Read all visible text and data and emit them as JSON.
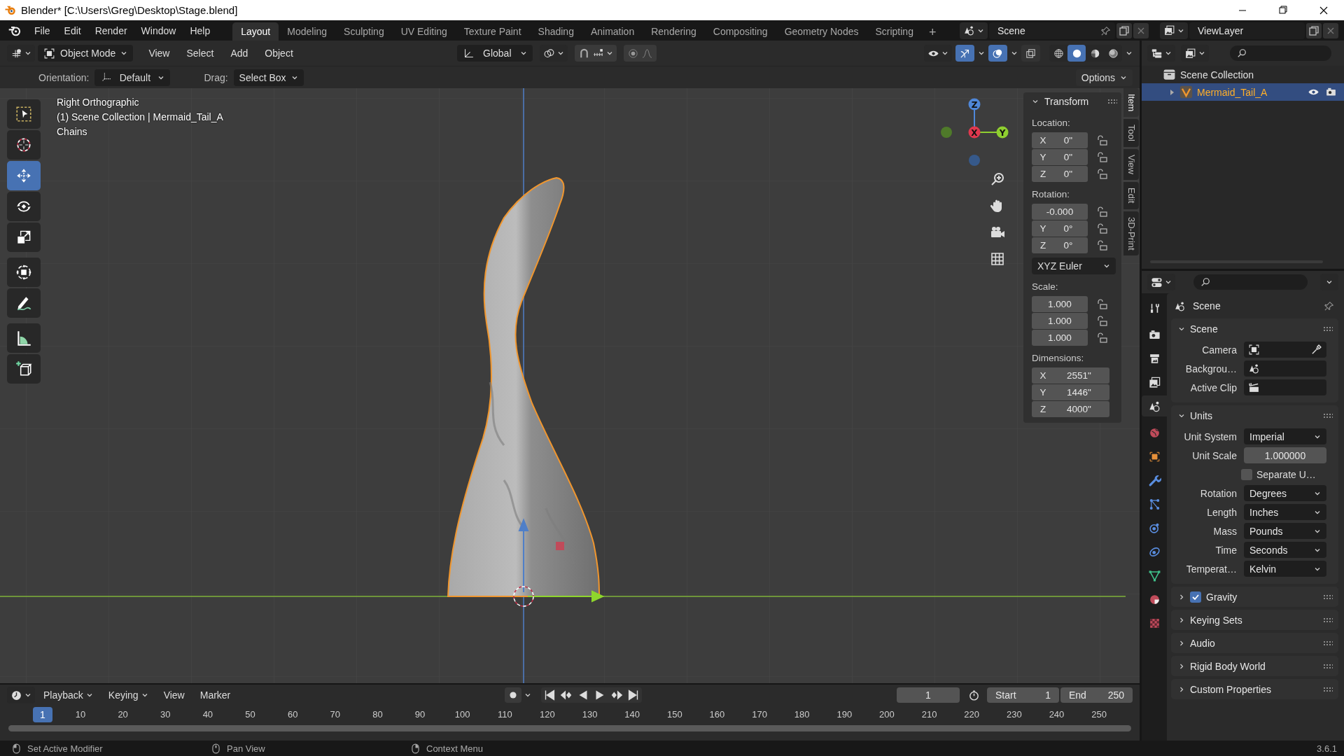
{
  "window": {
    "title": "Blender* [C:\\Users\\Greg\\Desktop\\Stage.blend]"
  },
  "menu": [
    "File",
    "Edit",
    "Render",
    "Window",
    "Help"
  ],
  "workspaces": [
    {
      "label": "Layout",
      "selected": true
    },
    {
      "label": "Modeling",
      "selected": false
    },
    {
      "label": "Sculpting",
      "selected": false
    },
    {
      "label": "UV Editing",
      "selected": false
    },
    {
      "label": "Texture Paint",
      "selected": false
    },
    {
      "label": "Shading",
      "selected": false
    },
    {
      "label": "Animation",
      "selected": false
    },
    {
      "label": "Rendering",
      "selected": false
    },
    {
      "label": "Compositing",
      "selected": false
    },
    {
      "label": "Geometry Nodes",
      "selected": false
    },
    {
      "label": "Scripting",
      "selected": false
    }
  ],
  "add_workspace": "+",
  "scene": "Scene",
  "view_layer": "ViewLayer",
  "viewport_header": {
    "mode": "Object Mode",
    "menus": [
      "View",
      "Select",
      "Add",
      "Object"
    ],
    "orientation": "Global",
    "gizmos_on": true,
    "overlays_on": true,
    "xray_on": false,
    "shading": [
      {
        "kind": "wireframe",
        "selected": false
      },
      {
        "kind": "solid",
        "selected": true
      },
      {
        "kind": "material",
        "selected": false
      },
      {
        "kind": "rendered",
        "selected": false
      }
    ]
  },
  "tool_settings": {
    "orientation_label": "Orientation:",
    "orientation": "Default",
    "drag_label": "Drag:",
    "drag": "Select Box",
    "options": "Options"
  },
  "viewport": {
    "lines": [
      "Right Orthographic",
      "(1) Scene Collection | Mermaid_Tail_A",
      "Chains"
    ]
  },
  "tools": [
    {
      "kind": "select",
      "selected": false
    },
    {
      "kind": "cursor",
      "selected": false
    },
    {
      "kind": "move",
      "selected": true
    },
    {
      "kind": "rotate",
      "selected": false
    },
    {
      "kind": "scale",
      "selected": false
    },
    {
      "kind": "transform",
      "selected": false
    },
    {
      "kind": "annotate",
      "selected": false
    },
    {
      "kind": "measure",
      "selected": false
    },
    {
      "kind": "addcube",
      "selected": false
    }
  ],
  "gizmo": {
    "z": "Z",
    "x": "X",
    "y": "Y"
  },
  "sidebar_tabs": [
    {
      "label": "Item",
      "selected": true
    },
    {
      "label": "Tool",
      "selected": false
    },
    {
      "label": "View",
      "selected": false
    },
    {
      "label": "Edit",
      "selected": false
    },
    {
      "label": "3D-Print",
      "selected": false
    }
  ],
  "transform": {
    "title": "Transform",
    "expanded": true,
    "groups": [
      {
        "label": "Location:",
        "locks": true,
        "rows": [
          {
            "axis": "X",
            "value": "0\""
          },
          {
            "axis": "Y",
            "value": "0\""
          },
          {
            "axis": "Z",
            "value": "0\""
          }
        ]
      },
      {
        "label": "Rotation:",
        "locks": true,
        "rows": [
          {
            "value": "-0.000"
          },
          {
            "axis": "Y",
            "value": "0°"
          },
          {
            "axis": "Z",
            "value": "0°"
          }
        ],
        "mode": "XYZ Euler"
      },
      {
        "label": "Scale:",
        "locks": true,
        "rows": [
          {
            "value": "1.000"
          },
          {
            "value": "1.000"
          },
          {
            "value": "1.000"
          }
        ]
      },
      {
        "label": "Dimensions:",
        "locks": false,
        "rows": [
          {
            "axis": "X",
            "value": "2551\""
          },
          {
            "axis": "Y",
            "value": "1446\""
          },
          {
            "axis": "Z",
            "value": "4000\""
          }
        ]
      }
    ]
  },
  "outliner": {
    "root": "Scene Collection",
    "items": [
      {
        "label": "Mermaid_Tail_A",
        "selected": true,
        "expanded": false,
        "visible": true
      }
    ]
  },
  "properties": {
    "context": "Scene",
    "tabs": [
      {
        "kind": "tool",
        "selected": false
      },
      {
        "kind": "render",
        "selected": false
      },
      {
        "kind": "output",
        "selected": false
      },
      {
        "kind": "viewlayer",
        "selected": false
      },
      {
        "kind": "scene",
        "selected": true
      },
      {
        "kind": "world",
        "selected": false
      },
      {
        "kind": "object",
        "selected": false
      },
      {
        "kind": "modifiers",
        "selected": false
      },
      {
        "kind": "particles",
        "selected": false
      },
      {
        "kind": "physics",
        "selected": false
      },
      {
        "kind": "constraints",
        "selected": false
      },
      {
        "kind": "data",
        "selected": false
      },
      {
        "kind": "material",
        "selected": false
      },
      {
        "kind": "texture",
        "selected": false
      }
    ],
    "panels": [
      {
        "title": "Scene",
        "expanded": true,
        "rows": [
          {
            "kind": "camera",
            "label": "Camera"
          },
          {
            "kind": "scene",
            "label": "Backgrou…"
          },
          {
            "kind": "clip",
            "label": "Active Clip"
          }
        ]
      },
      {
        "title": "Units",
        "expanded": true,
        "rows": [
          {
            "kind": "dropdown",
            "label": "Unit System",
            "value": "Imperial"
          },
          {
            "kind": "number",
            "label": "Unit Scale",
            "value": "1.000000"
          },
          {
            "kind": "checkbox",
            "label": "Separate U…",
            "checked": false
          },
          {
            "kind": "dropdown",
            "label": "Rotation",
            "value": "Degrees"
          },
          {
            "kind": "dropdown",
            "label": "Length",
            "value": "Inches"
          },
          {
            "kind": "dropdown",
            "label": "Mass",
            "value": "Pounds"
          },
          {
            "kind": "dropdown",
            "label": "Time",
            "value": "Seconds"
          },
          {
            "kind": "dropdown",
            "label": "Temperat…",
            "value": "Kelvin"
          }
        ]
      },
      {
        "title": "Gravity",
        "expanded": false,
        "checked": true
      },
      {
        "title": "Keying Sets",
        "expanded": false
      },
      {
        "title": "Audio",
        "expanded": false
      },
      {
        "title": "Rigid Body World",
        "expanded": false
      },
      {
        "title": "Custom Properties",
        "expanded": false
      }
    ]
  },
  "timeline": {
    "menus": [
      "Playback",
      "Keying",
      "View",
      "Marker"
    ],
    "current_frame": "1",
    "start_label": "Start",
    "start": "1",
    "end_label": "End",
    "end": "250",
    "playhead": "1",
    "ruler": [
      "10",
      "20",
      "30",
      "40",
      "50",
      "60",
      "70",
      "80",
      "90",
      "100",
      "110",
      "120",
      "130",
      "140",
      "150",
      "160",
      "170",
      "180",
      "190",
      "200",
      "210",
      "220",
      "230",
      "240",
      "250"
    ]
  },
  "status_bar": {
    "hints": [
      {
        "kind": "left",
        "label": "Set Active Modifier"
      },
      {
        "kind": "middle",
        "label": "Pan View"
      },
      {
        "kind": "right",
        "label": "Context Menu"
      }
    ],
    "version": "3.6.1"
  }
}
